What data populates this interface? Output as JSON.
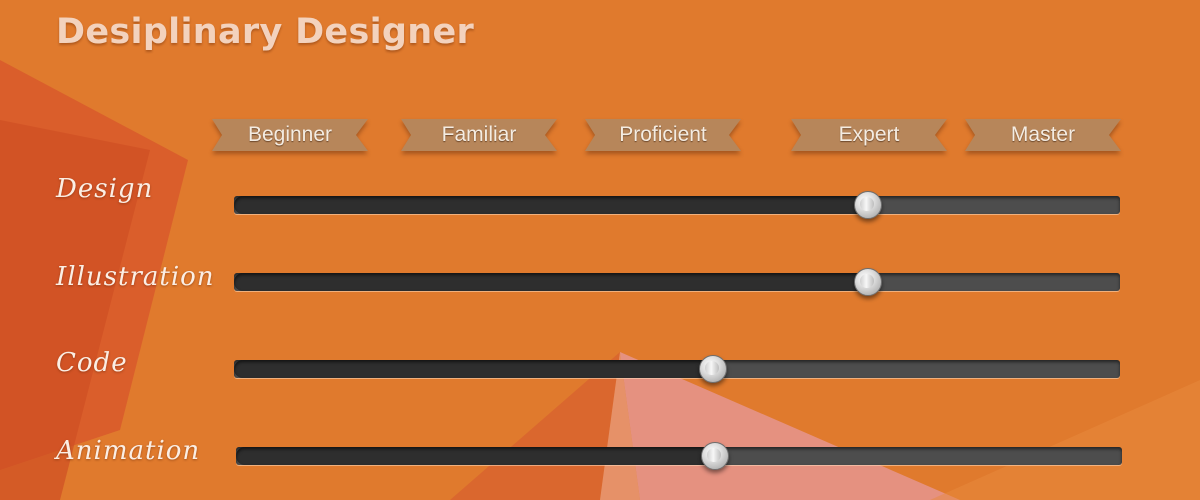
{
  "title": "Desiplinary Designer",
  "levels": [
    "Beginner",
    "Familiar",
    "Proficient",
    "Expert",
    "Master"
  ],
  "skills": [
    {
      "label": "Design",
      "value": 0.715
    },
    {
      "label": "Illustration",
      "value": 0.715
    },
    {
      "label": "Code",
      "value": 0.54
    },
    {
      "label": "Animation",
      "value": 0.54
    }
  ],
  "colors": {
    "background": "#e07a2d",
    "title": "#f3d2bd",
    "ribbon": "#b7865a",
    "track": "#4d4d4d",
    "track_fill": "#2e2e2e"
  }
}
